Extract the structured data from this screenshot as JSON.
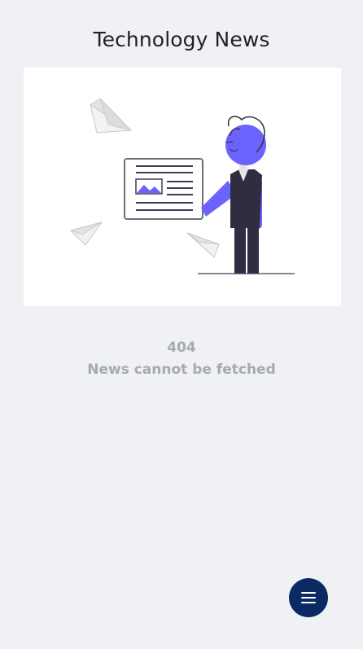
{
  "header": {
    "title": "Technology News"
  },
  "illustration": {
    "icon": "person-presenting-news-board-illustration",
    "accent_color": "#6c63ff",
    "dark_color": "#2f2e41"
  },
  "error": {
    "code": "404",
    "message": "News cannot be fetched",
    "color": "#a7aba7"
  },
  "fab": {
    "icon": "menu-icon",
    "color": "#0b2a63"
  }
}
